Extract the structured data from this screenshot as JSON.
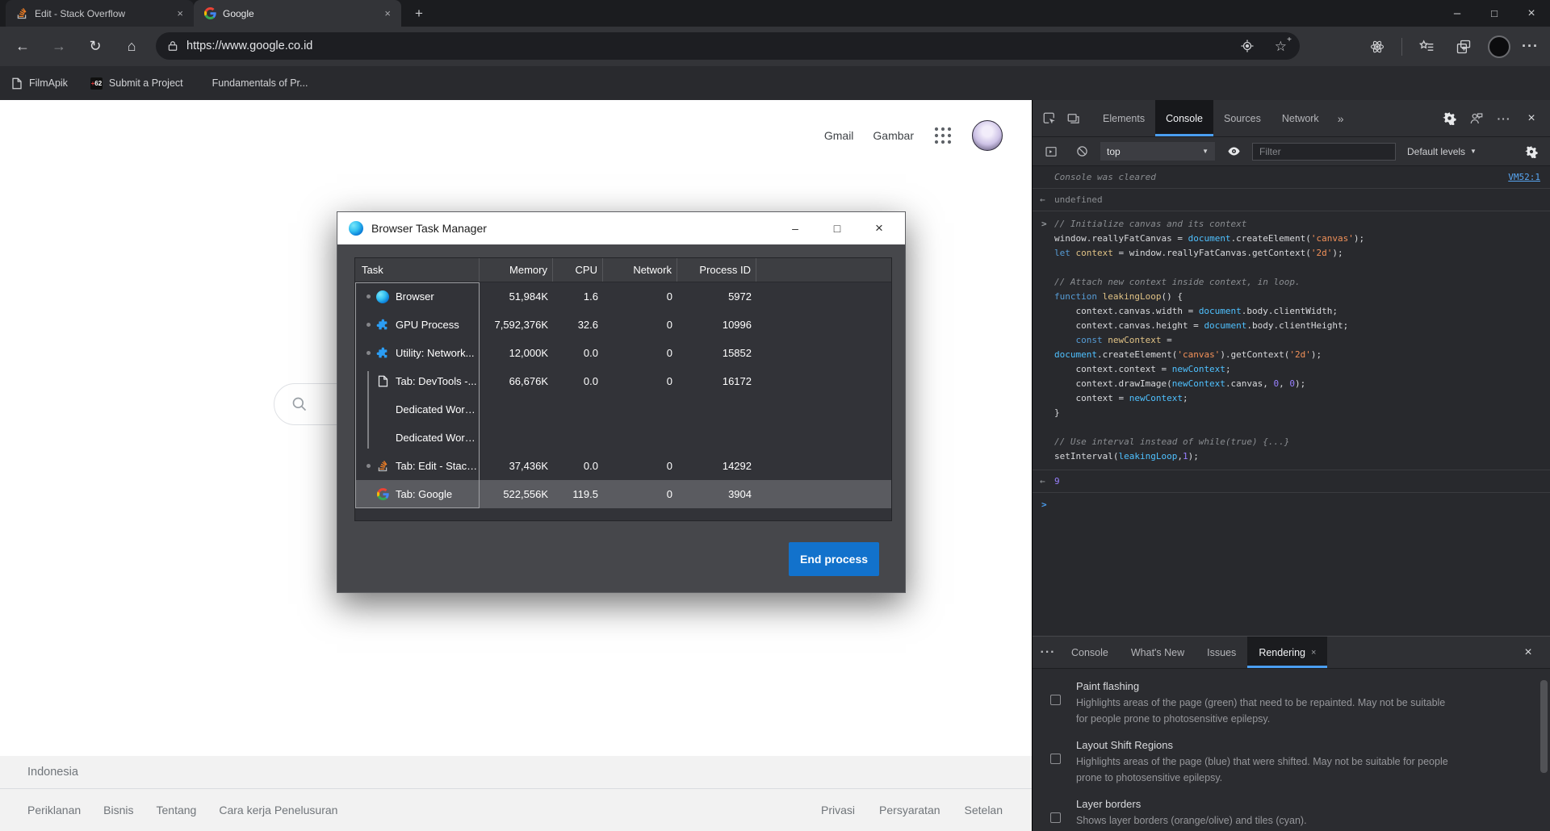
{
  "glyphs": {
    "back": "←",
    "forward": "→",
    "refresh": "↻",
    "home": "⌂",
    "minimize": "–",
    "maximize": "□",
    "close": "×",
    "new_tab": "+",
    "overflow": "···",
    "more_tabs": "»",
    "dropdown": "▼",
    "drawer_more": "···",
    "star": "☆"
  },
  "browser": {
    "tabs": [
      {
        "title": "Edit - Stack Overflow",
        "icon": "stackoverflow",
        "active": false
      },
      {
        "title": "Google",
        "icon": "google",
        "active": true
      }
    ],
    "url": "https://www.google.co.id",
    "bookmarks": [
      {
        "label": "FilmApik",
        "icon": "page"
      },
      {
        "label": "Submit a Project",
        "icon": "plus62"
      },
      {
        "label": "Fundamentals of Pr...",
        "icon": "bluesquare"
      }
    ]
  },
  "google_page": {
    "gmail": "Gmail",
    "images": "Gambar",
    "footer": {
      "country": "Indonesia",
      "links_left": [
        "Periklanan",
        "Bisnis",
        "Tentang",
        "Cara kerja Penelusuran"
      ],
      "links_right": [
        "Privasi",
        "Persyaratan",
        "Setelan"
      ]
    }
  },
  "task_manager": {
    "title": "Browser Task Manager",
    "columns": [
      "Task",
      "Memory",
      "CPU",
      "Network",
      "Process ID"
    ],
    "rows": [
      {
        "icon": "edge",
        "marker": "dot",
        "task": "Browser",
        "memory": "51,984K",
        "cpu": "1.6",
        "network": "0",
        "pid": "5972",
        "selected": false
      },
      {
        "icon": "puzzle",
        "marker": "dot",
        "task": "GPU Process",
        "memory": "7,592,376K",
        "cpu": "32.6",
        "network": "0",
        "pid": "10996",
        "selected": false
      },
      {
        "icon": "puzzle",
        "marker": "dot",
        "task": "Utility: Network...",
        "memory": "12,000K",
        "cpu": "0.0",
        "network": "0",
        "pid": "15852",
        "selected": false
      },
      {
        "icon": "page",
        "marker": "none",
        "task": "Tab: DevTools -...",
        "memory": "66,676K",
        "cpu": "0.0",
        "network": "0",
        "pid": "16172",
        "selected": false
      },
      {
        "icon": "none",
        "marker": "none",
        "task": "Dedicated Worke...",
        "memory": "",
        "cpu": "",
        "network": "",
        "pid": "",
        "selected": false
      },
      {
        "icon": "none",
        "marker": "none",
        "task": "Dedicated Worke...",
        "memory": "",
        "cpu": "",
        "network": "",
        "pid": "",
        "selected": false
      },
      {
        "icon": "stackoverflow",
        "marker": "dot",
        "task": "Tab: Edit - Stack...",
        "memory": "37,436K",
        "cpu": "0.0",
        "network": "0",
        "pid": "14292",
        "selected": false
      },
      {
        "icon": "google",
        "marker": "none",
        "task": "Tab: Google",
        "memory": "522,556K",
        "cpu": "119.5",
        "network": "0",
        "pid": "3904",
        "selected": true
      }
    ],
    "end_process": "End process"
  },
  "devtools": {
    "tabs": [
      "Elements",
      "Console",
      "Sources",
      "Network"
    ],
    "active_tab": "Console",
    "console_toolbar": {
      "context": "top",
      "filter_placeholder": "Filter",
      "levels": "Default levels"
    },
    "console": {
      "cleared": "Console was cleared",
      "link": "VM52:1",
      "result_undefined": "undefined",
      "result_value": "9",
      "code": [
        [
          [
            "c",
            "// Initialize canvas and its context"
          ]
        ],
        [
          [
            "p",
            "window.reallyFatCanvas = "
          ],
          [
            "b",
            "document"
          ],
          [
            "p",
            ".createElement("
          ],
          [
            "s",
            "'canvas'"
          ],
          [
            "p",
            ");"
          ]
        ],
        [
          [
            "k",
            "let"
          ],
          [
            "p",
            " "
          ],
          [
            "v",
            "context"
          ],
          [
            "p",
            " = window.reallyFatCanvas.getContext("
          ],
          [
            "s",
            "'2d'"
          ],
          [
            "p",
            ");"
          ]
        ],
        [],
        [
          [
            "c",
            "// Attach new context inside context, in loop."
          ]
        ],
        [
          [
            "k",
            "function"
          ],
          [
            "p",
            " "
          ],
          [
            "v",
            "leakingLoop"
          ],
          [
            "p",
            "() {"
          ]
        ],
        [
          [
            "p",
            "    context.canvas.width = "
          ],
          [
            "b",
            "document"
          ],
          [
            "p",
            ".body.clientWidth;"
          ]
        ],
        [
          [
            "p",
            "    context.canvas.height = "
          ],
          [
            "b",
            "document"
          ],
          [
            "p",
            ".body.clientHeight;"
          ]
        ],
        [
          [
            "p",
            "    "
          ],
          [
            "k",
            "const"
          ],
          [
            "p",
            " "
          ],
          [
            "v",
            "newContext"
          ],
          [
            "p",
            " ="
          ]
        ],
        [
          [
            "b",
            "document"
          ],
          [
            "p",
            ".createElement("
          ],
          [
            "s",
            "'canvas'"
          ],
          [
            "p",
            ").getContext("
          ],
          [
            "s",
            "'2d'"
          ],
          [
            "p",
            ");"
          ]
        ],
        [
          [
            "p",
            "    context.context = "
          ],
          [
            "b",
            "newContext"
          ],
          [
            "p",
            ";"
          ]
        ],
        [
          [
            "p",
            "    context.drawImage("
          ],
          [
            "b",
            "newContext"
          ],
          [
            "p",
            ".canvas, "
          ],
          [
            "n",
            "0"
          ],
          [
            "p",
            ", "
          ],
          [
            "n",
            "0"
          ],
          [
            "p",
            ");"
          ]
        ],
        [
          [
            "p",
            "    context = "
          ],
          [
            "b",
            "newContext"
          ],
          [
            "p",
            ";"
          ]
        ],
        [
          [
            "p",
            "}"
          ]
        ],
        [],
        [
          [
            "c",
            "// Use interval instead of while(true) {...}"
          ]
        ],
        [
          [
            "p",
            "setInterval("
          ],
          [
            "b",
            "leakingLoop"
          ],
          [
            "p",
            ","
          ],
          [
            "n",
            "1"
          ],
          [
            "p",
            ");"
          ]
        ]
      ]
    },
    "drawer": {
      "tabs": [
        "Console",
        "What's New",
        "Issues",
        "Rendering"
      ],
      "active": "Rendering"
    },
    "rendering": [
      {
        "title": "Paint flashing",
        "desc": "Highlights areas of the page (green) that need to be repainted. May not be suitable for people prone to photosensitive epilepsy."
      },
      {
        "title": "Layout Shift Regions",
        "desc": "Highlights areas of the page (blue) that were shifted. May not be suitable for people prone to photosensitive epilepsy."
      },
      {
        "title": "Layer borders",
        "desc": "Shows layer borders (orange/olive) and tiles (cyan)."
      }
    ]
  }
}
